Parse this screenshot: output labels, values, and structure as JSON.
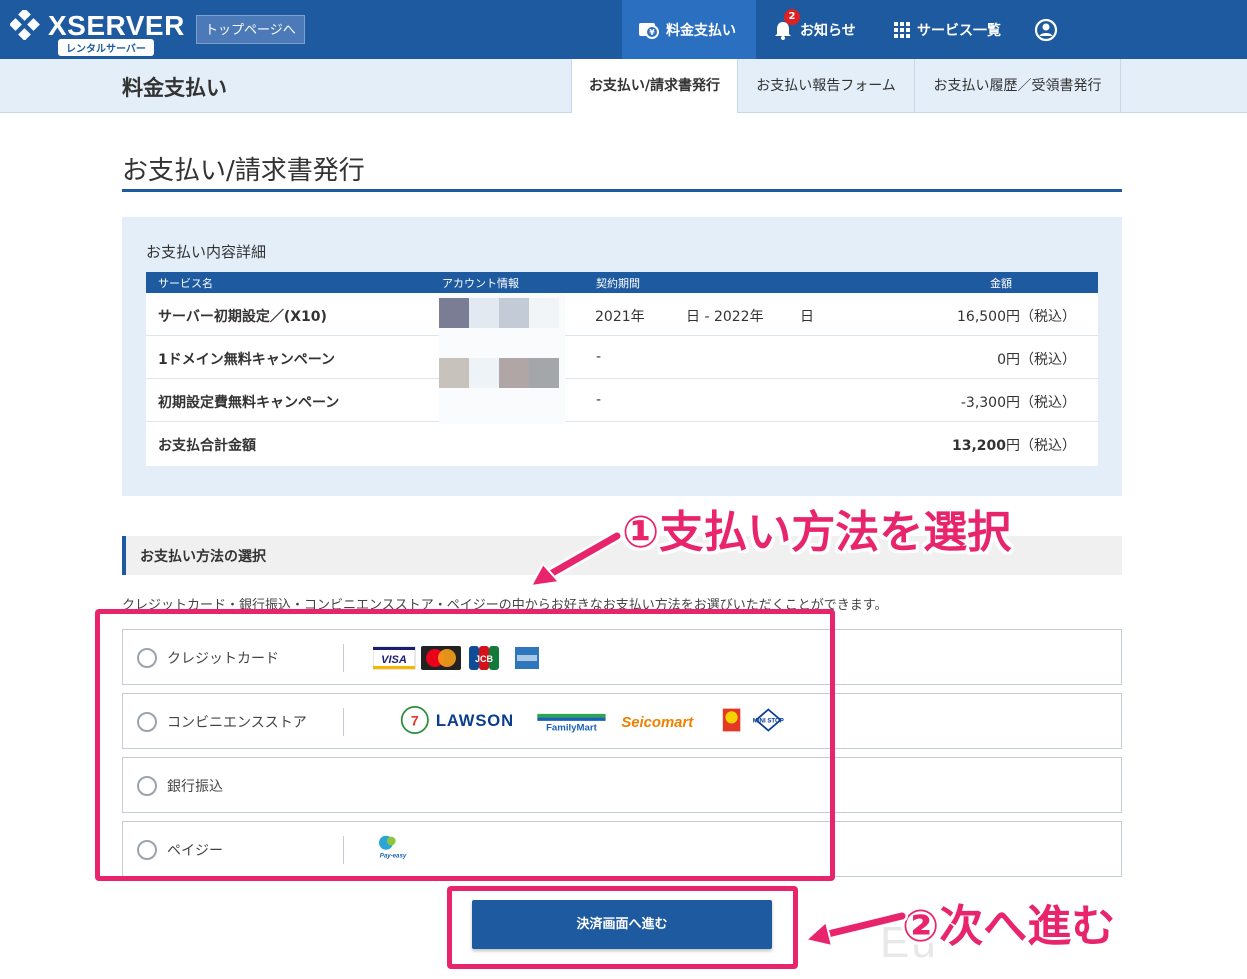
{
  "brand": {
    "name": "XSERVER",
    "sub": "レンタルサーバー",
    "top_link": "トップページへ"
  },
  "nav": {
    "items": [
      {
        "label": "料金支払い"
      },
      {
        "label": "お知らせ",
        "badge": "2"
      },
      {
        "label": "サービス一覧"
      }
    ]
  },
  "subheader": {
    "title": "料金支払い",
    "tabs": [
      {
        "label": "お支払い/請求書発行"
      },
      {
        "label": "お支払い報告フォーム"
      },
      {
        "label": "お支払い履歴／受領書発行"
      }
    ]
  },
  "page": {
    "title": "お支払い/請求書発行"
  },
  "details": {
    "title": "お支払い内容詳細",
    "headers": [
      "サービス名",
      "アカウント情報",
      "契約期間",
      "金額"
    ],
    "rows": [
      {
        "name": "サーバー初期設定／(X10)",
        "period_a": "2021年",
        "period_b": "日 - 2022年",
        "period_c": "日",
        "amount": "16,500円（税込）"
      },
      {
        "name": "1ドメイン無料キャンペーン",
        "period_a": "-",
        "amount": "0円（税込）"
      },
      {
        "name": "初期設定費無料キャンペーン",
        "period_a": "-",
        "amount": "-3,300円（税込）"
      }
    ],
    "total": {
      "label": "お支払合計金額",
      "value": "13,200",
      "suffix": "円（税込）"
    }
  },
  "method": {
    "heading": "お支払い方法の選択",
    "description": "クレジットカード・銀行振込・コンビニエンスストア・ペイジーの中からお好きなお支払い方法をお選びいただくことができます。",
    "options": [
      {
        "label": "クレジットカード",
        "logos": [
          "VISA",
          "mastercard-logo",
          "JCB",
          "amex-logo"
        ]
      },
      {
        "label": "コンビニエンスストア",
        "logos": [
          "seven-eleven-logo",
          "LAWSON",
          "FamilyMart",
          "Seicomart",
          "daily-logo",
          "MINI STOP"
        ]
      },
      {
        "label": "銀行振込"
      },
      {
        "label": "ペイジー",
        "logos": [
          "Pay-easy"
        ]
      }
    ]
  },
  "submit_label": "決済画面へ進む",
  "annotations": {
    "note1": "①支払い方法を選択",
    "note2": "②次へ進む",
    "color": "#e8256c"
  },
  "colors": {
    "primary": "#1e5aa0",
    "subheader_bg": "#e4eef8"
  }
}
